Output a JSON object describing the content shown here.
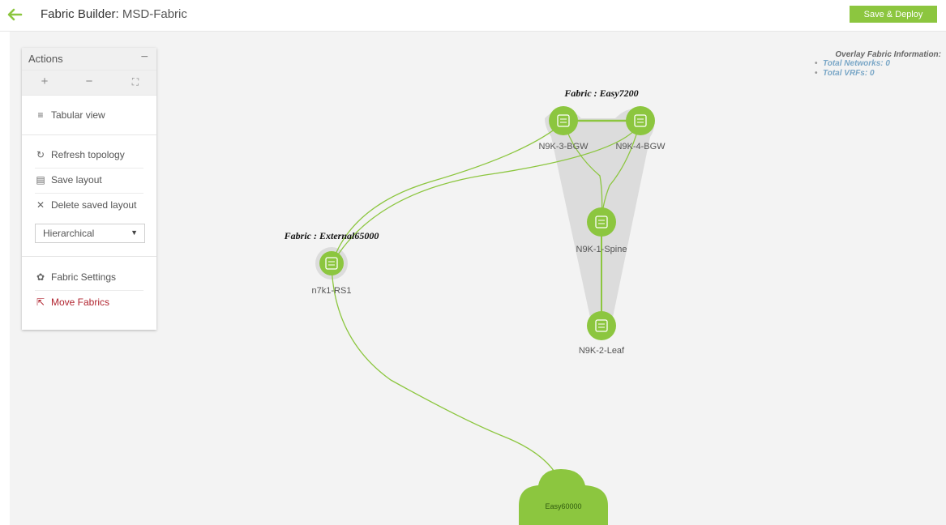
{
  "header": {
    "title_prefix": "Fabric Builder:",
    "fabric_name": "MSD-Fabric",
    "deploy_label": "Save & Deploy"
  },
  "actions": {
    "title": "Actions",
    "collapse_glyph": "−",
    "zoom_in_glyph": "+",
    "zoom_out_glyph": "−",
    "fit_glyph": "⛶",
    "tabular_view": "Tabular view",
    "refresh_topology": "Refresh topology",
    "save_layout": "Save layout",
    "delete_saved_layout": "Delete saved layout",
    "layout_selected": "Hierarchical",
    "fabric_settings": "Fabric Settings",
    "move_fabrics": "Move Fabrics"
  },
  "overlay": {
    "heading": "Overlay Fabric Information:",
    "total_networks": "Total Networks: 0",
    "total_vrfs": "Total VRFs: 0"
  },
  "topology": {
    "fabric_easy": "Fabric : Easy7200",
    "fabric_external": "Fabric : External65000",
    "nodes": {
      "bgw3": "N9K-3-BGW",
      "bgw4": "N9K-4-BGW",
      "spine": "N9K-1-Spine",
      "leaf": "N9K-2-Leaf",
      "rs1": "n7k1-RS1"
    },
    "cloud": "Easy60000"
  },
  "colors": {
    "accent": "#8cc63f",
    "node": "#8cc63f",
    "link": "#8cc63f",
    "fabric_group": "#dcdcdc",
    "move_fabrics": "#b1242f",
    "overlay_value": "#7aa7c7"
  }
}
